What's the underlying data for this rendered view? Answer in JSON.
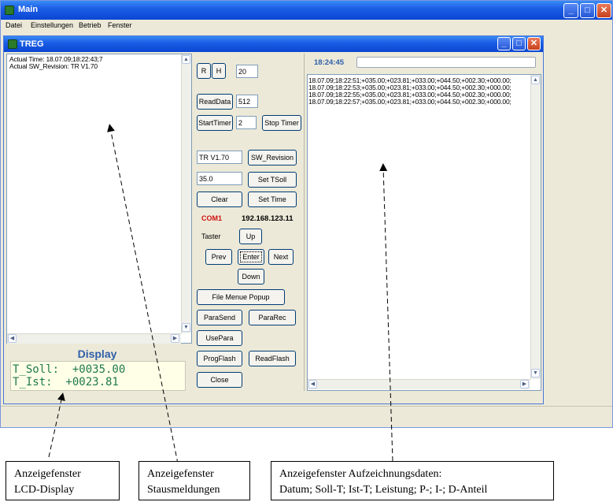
{
  "main_window": {
    "title": "Main",
    "menu": [
      "Datei",
      "Einstellungen",
      "Betrieb",
      "Fenster"
    ],
    "caption_buttons": [
      "minimize-icon",
      "maximize-icon",
      "close-icon"
    ]
  },
  "treg_window": {
    "title": "TREG",
    "status_log": [
      "Actual Time: 18.07.09;18:22:43;7",
      "Actual SW_Revision: TR V1.70"
    ],
    "controls": {
      "r_button": "R",
      "h_button": "H",
      "r_h_value": "20",
      "read_data_button": "ReadData",
      "read_data_value": "512",
      "start_timer_button": "StartTimer",
      "timer_value": "2",
      "stop_timer_button": "Stop Timer",
      "revision_value": "TR V1.70",
      "sw_revision_button": "SW_Revision",
      "tsoll_value": "35.0",
      "set_tsoll_button": "Set TSoll",
      "clear_button": "Clear",
      "set_time_button": "Set Time",
      "com_port": "COM1",
      "ip_address": "192.168.123.11",
      "taster_label": "Taster",
      "up_button": "Up",
      "prev_button": "Prev",
      "enter_button": "Enter",
      "next_button": "Next",
      "down_button": "Down",
      "file_menu_button": "File Menue Popup",
      "para_send_button": "ParaSend",
      "para_rec_button": "ParaRec",
      "use_para_button": "UsePara",
      "prog_flash_button": "ProgFlash",
      "read_flash_button": "ReadFlash",
      "close_button": "Close"
    },
    "record": {
      "time": "18:24:45",
      "lines": [
        "18.07.09;18:22:51;+035.00;+023.81;+033.00;+044.50;+002.30;+000.00;",
        "18.07.09;18:22:53;+035.00;+023.81;+033.00;+044.50;+002.30;+000.00;",
        "18.07.09;18:22:55;+035.00;+023.81;+033.00;+044.50;+002.30;+000.00;",
        "18.07.09;18:22:57;+035.00;+023.81;+033.00;+044.50;+002.30;+000.00;"
      ]
    },
    "lcd": {
      "heading": "Display",
      "line1": "T_Soll:  +0035.00",
      "line2": "T_Ist:  +0023.81"
    }
  },
  "callouts": {
    "lcd_line1": "Anzeigefenster",
    "lcd_line2": "LCD-Display",
    "status_line1": "Anzeigefenster",
    "status_line2": "Stausmeldungen",
    "record_line1": "Anzeigefenster Aufzeichnungsdaten:",
    "record_line2": "Datum; Soll-T; Ist-T; Leistung; P-; I-; D-Anteil"
  },
  "colors": {
    "titlebar": "#0a46d2",
    "com_port": "#d01010",
    "lcd_text": "#1f7a4a",
    "lcd_heading": "#2f5fa9",
    "time_label": "#2f5fa9"
  }
}
